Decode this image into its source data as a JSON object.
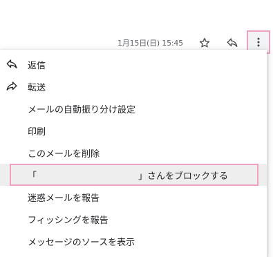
{
  "header": {
    "timestamp": "1月15日(日) 15:45",
    "icons": [
      "star-icon",
      "reply-icon",
      "more-vert-icon"
    ]
  },
  "menu": {
    "reply_label": "返信",
    "forward_label": "転送",
    "filter_label": "メールの自動振り分け設定",
    "print_label": "印刷",
    "delete_label": "このメールを削除",
    "block_open": "「",
    "block_close": "」さんをブロックする",
    "spam_label": "迷惑メールを報告",
    "phishing_label": "フィッシングを報告",
    "source_label": "メッセージのソースを表示"
  },
  "colors": {
    "highlight_border": "#f0a0c0",
    "highlight_bg": "#eeeeee",
    "text": "#202124",
    "muted": "#5f6368"
  }
}
